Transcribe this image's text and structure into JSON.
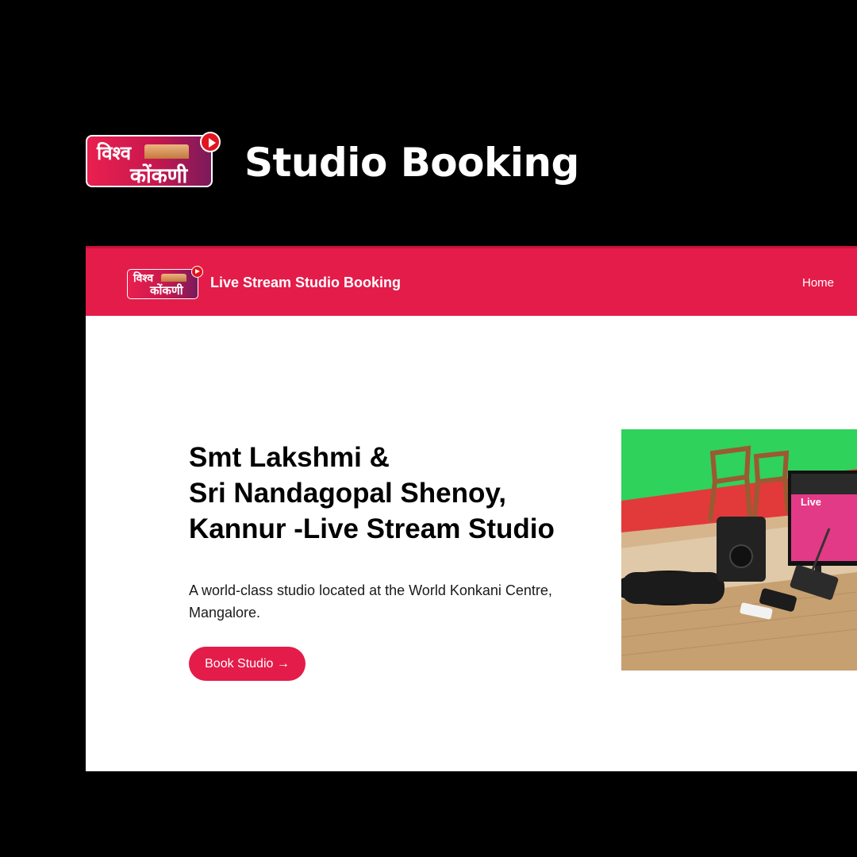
{
  "showcase": {
    "title": "Studio Booking",
    "logo": {
      "line1": "विश्व",
      "line2": "कोंकणी"
    }
  },
  "navbar": {
    "logo": {
      "line1": "विश्व",
      "line2": "कोंकणी"
    },
    "title": "Live Stream Studio Booking",
    "home_label": "Home"
  },
  "hero": {
    "title_lines": [
      "Smt Lakshmi &",
      "Sri Nandagopal Shenoy,",
      "Kannur -Live Stream Studio"
    ],
    "description": "A world-class studio located at the World Konkani Centre, Mangalore.",
    "button_label": "Book Studio →",
    "monitor_text": "Live"
  },
  "colors": {
    "brand": "#e41c4a",
    "background": "#000000",
    "page": "#ffffff",
    "green_screen": "#2fd25b"
  },
  "icons": [
    "play-icon",
    "arrow-right-icon"
  ]
}
